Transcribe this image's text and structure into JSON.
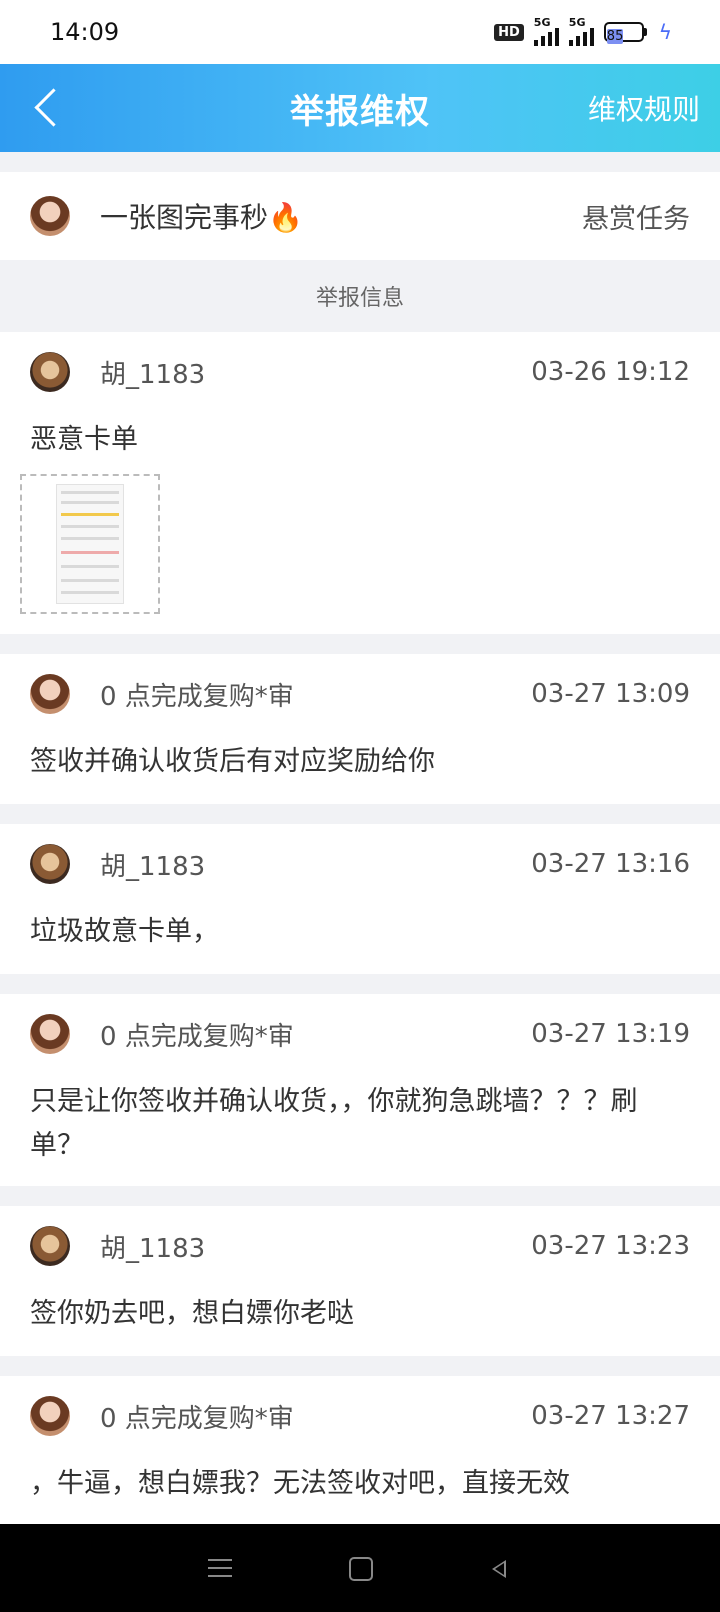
{
  "status": {
    "time": "14:09",
    "hd_label": "HD",
    "sim1": "5G",
    "sim2": "5G",
    "battery": "85"
  },
  "navbar": {
    "title": "举报维权",
    "rules_label": "维权规则"
  },
  "task": {
    "name": "一张图完事秒",
    "emoji": "🔥",
    "tag": "悬赏任务"
  },
  "section_label": "举报信息",
  "messages": [
    {
      "user": "胡_1183",
      "time": "03-26 19:12",
      "text": "恶意卡单"
    },
    {
      "user": "0 点完成复购*审",
      "time": "03-27 13:09",
      "text": "签收并确认收货后有对应奖励给你"
    },
    {
      "user": "胡_1183",
      "time": "03-27 13:16",
      "text": "垃圾故意卡单，"
    },
    {
      "user": "0 点完成复购*审",
      "time": "03-27 13:19",
      "text": "只是让你签收并确认收货，，你就狗急跳墙？？？刷单？"
    },
    {
      "user": "胡_1183",
      "time": "03-27 13:23",
      "text": "签你奶去吧，想白嫖你老哒"
    },
    {
      "user": "0 点完成复购*审",
      "time": "03-27 13:27",
      "text": "，牛逼，想白嫖我？无法签收对吧，直接无效"
    }
  ]
}
